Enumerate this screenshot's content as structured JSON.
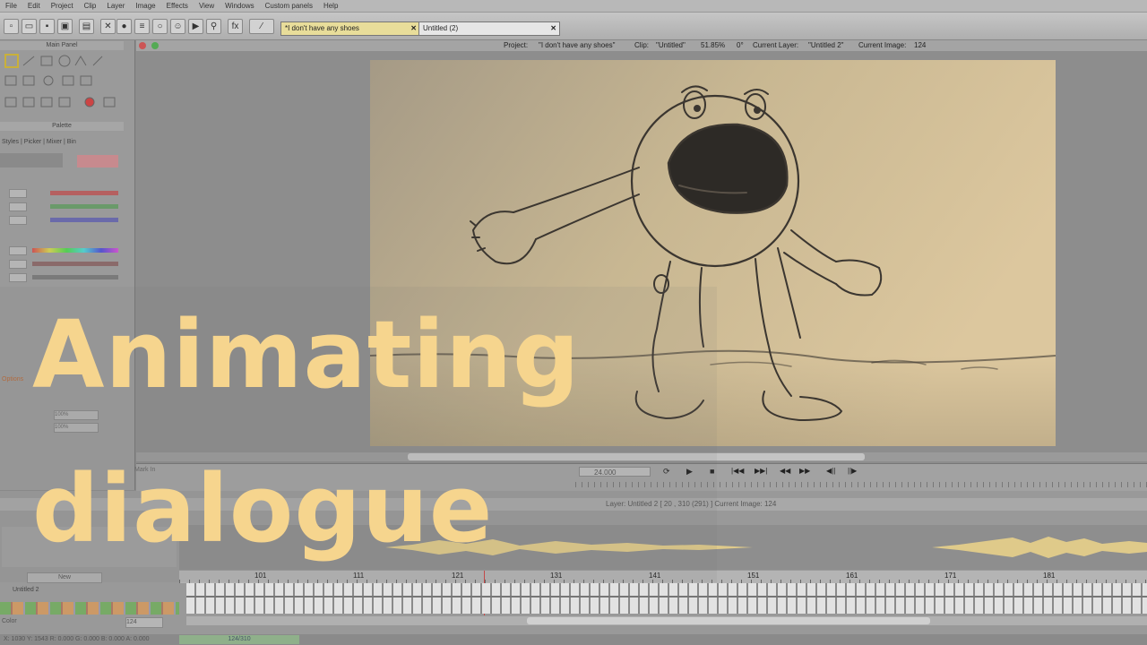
{
  "menu": [
    "File",
    "Edit",
    "Project",
    "Clip",
    "Layer",
    "Image",
    "Effects",
    "View",
    "Windows",
    "Custom panels",
    "Help"
  ],
  "tabs": [
    {
      "label": "*I don't have any shoes",
      "active": true
    },
    {
      "label": "Untitled (2)",
      "active": false
    }
  ],
  "panels": {
    "main_panel": "Main Panel",
    "palette": "Palette",
    "palette_tabs": "Styles | Picker | Mixer | Bin",
    "options": "Options",
    "pct1": "100%",
    "pct2": "100%"
  },
  "info": {
    "project_label": "Project:",
    "project": "\"I don't have any shoes\"",
    "clip_label": "Clip:",
    "clip": "\"Untitled\"",
    "zoom": "51.85%",
    "rotation": "0°",
    "layer_label": "Current Layer:",
    "layer": "\"Untitled 2\"",
    "image_label": "Current Image:",
    "image": "124"
  },
  "transport": {
    "fps": "24.000"
  },
  "layer_bar": {
    "text": "Layer: Untitled 2 [ 20 , 310 (291) ]   Current Image: 124",
    "new_label": "New",
    "layer_name": "Untitled 2",
    "mark_in": "Mark In",
    "frame_field": "124",
    "color_label": "Color"
  },
  "ruler": [
    "101",
    "111",
    "121",
    "131",
    "141",
    "151",
    "161",
    "171",
    "181"
  ],
  "status": {
    "counter": "124/310",
    "coords": "X: 1030  Y: 1543  R: 0.000  G: 0.000  B: 0.000  A: 0.000"
  },
  "title": {
    "line1": "Animating",
    "line2": "dialogue"
  },
  "colors": {
    "title": "#f6d58e",
    "canvas_paper": "#d2bf98",
    "ui_gray": "#9a9a9a"
  }
}
